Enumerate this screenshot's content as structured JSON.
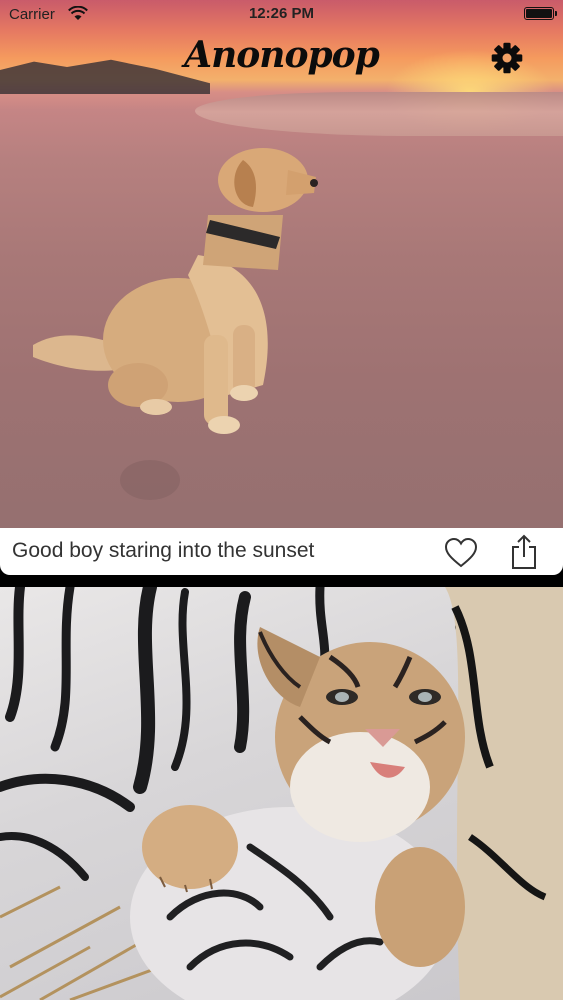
{
  "status_bar": {
    "carrier": "Carrier",
    "time": "12:26 PM"
  },
  "header": {
    "app_title": "Anonopop"
  },
  "feed": {
    "posts": [
      {
        "caption": "Good boy staring into the sunset"
      }
    ]
  },
  "icons": {
    "settings": "gear-icon",
    "like": "heart-icon",
    "share": "share-icon"
  },
  "colors": {
    "title": "#0c0c0c",
    "caption_background": "#ffffff",
    "caption_text": "#333333"
  }
}
